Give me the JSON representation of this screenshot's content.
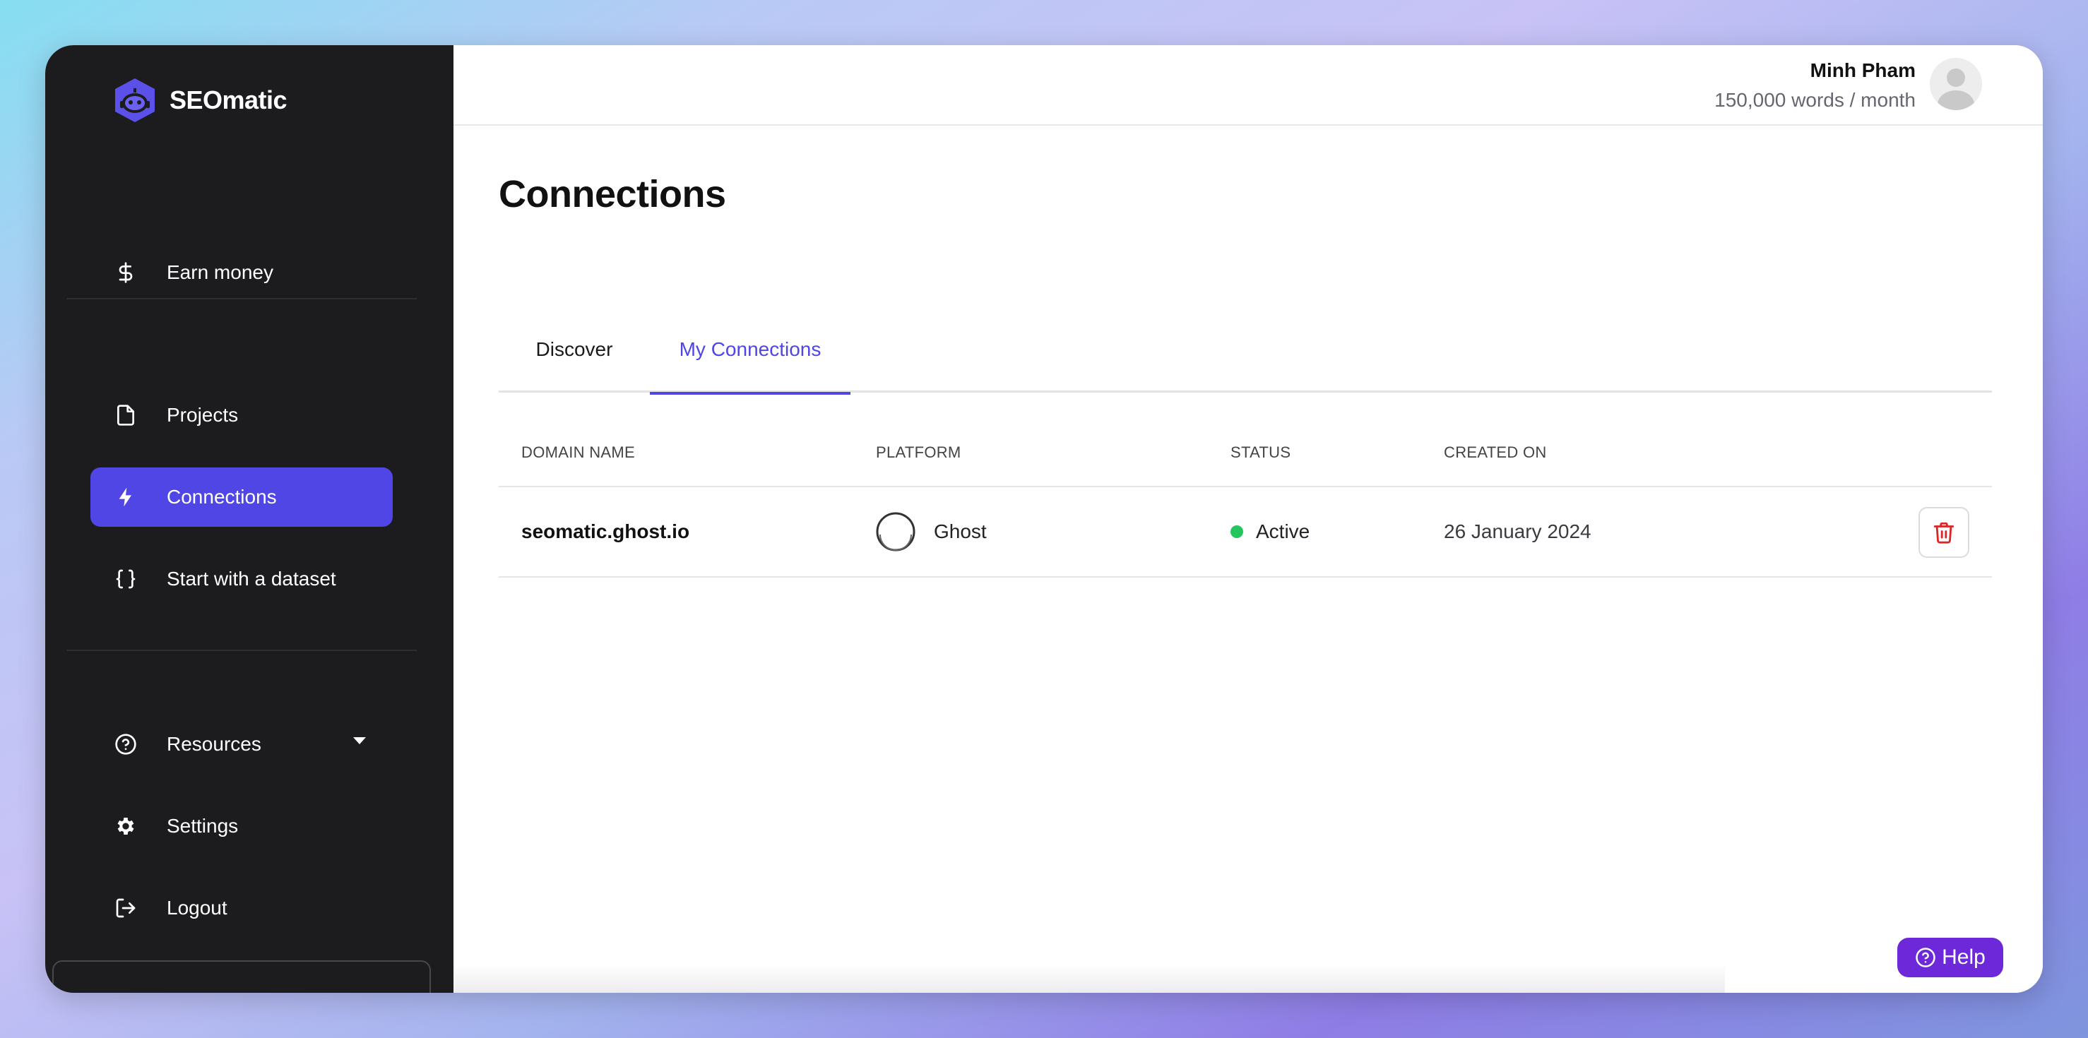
{
  "brand": {
    "name": "SEOmatic",
    "logo_icon": "robot-logo-icon",
    "accent": "#5046e5"
  },
  "sidebar": {
    "items": [
      {
        "label": "Earn money",
        "icon": "dollar-icon"
      },
      {
        "label": "Projects",
        "icon": "file-icon"
      },
      {
        "label": "Connections",
        "icon": "lightning-icon",
        "active": true
      },
      {
        "label": "Start with a dataset",
        "icon": "braces-icon"
      },
      {
        "label": "Resources",
        "icon": "question-circle-icon",
        "has_dropdown": true
      },
      {
        "label": "Settings",
        "icon": "gear-icon"
      },
      {
        "label": "Logout",
        "icon": "logout-icon"
      }
    ]
  },
  "user": {
    "name": "Minh Pham",
    "quota": "150,000 words / month"
  },
  "page": {
    "title": "Connections"
  },
  "tabs": [
    {
      "label": "Discover",
      "active": false
    },
    {
      "label": "My Connections",
      "active": true
    }
  ],
  "table": {
    "headers": [
      "DOMAIN NAME",
      "PLATFORM",
      "STATUS",
      "CREATED ON"
    ],
    "rows": [
      {
        "domain": "seomatic.ghost.io",
        "platform": "Ghost",
        "platform_icon": "ghost-logo-icon",
        "status": "Active",
        "status_color": "#22c55e",
        "created_on": "26 January 2024",
        "action_icon": "trash-icon",
        "action_color": "#dc2626"
      }
    ]
  },
  "help": {
    "label": "Help",
    "color": "#6d28d9"
  }
}
